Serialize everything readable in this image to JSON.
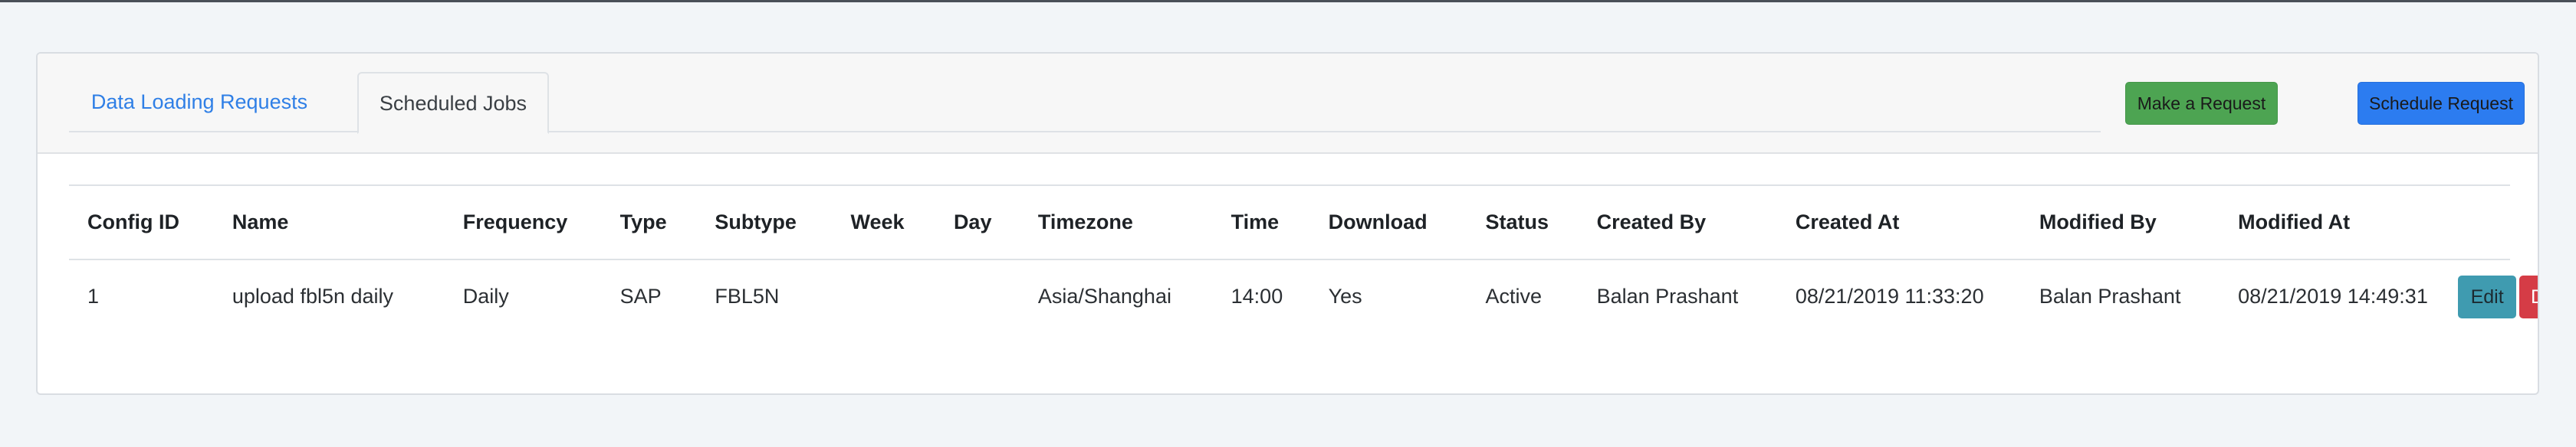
{
  "tabs": {
    "data_loading": "Data Loading Requests",
    "scheduled_jobs": "Scheduled Jobs"
  },
  "actions": {
    "make_request": "Make a Request",
    "schedule_request": "Schedule Request"
  },
  "table": {
    "headers": [
      "Config ID",
      "Name",
      "Frequency",
      "Type",
      "Subtype",
      "Week",
      "Day",
      "Timezone",
      "Time",
      "Download",
      "Status",
      "Created By",
      "Created At",
      "Modified By",
      "Modified At",
      ""
    ],
    "rows": [
      {
        "config_id": "1",
        "name": "upload fbl5n daily",
        "frequency": "Daily",
        "type": "SAP",
        "subtype": "FBL5N",
        "week": "",
        "day": "",
        "timezone": "Asia/Shanghai",
        "time": "14:00",
        "download": "Yes",
        "status": "Active",
        "created_by": "Balan Prashant",
        "created_at": "08/21/2019 11:33:20",
        "modified_by": "Balan Prashant",
        "modified_at": "08/21/2019 14:49:31",
        "edit_label": "Edit",
        "delete_label": "Delete"
      }
    ]
  },
  "colors": {
    "link": "#2f7fe6",
    "make_request_bg": "#4da452",
    "schedule_request_bg": "#2c7cf0",
    "edit_bg": "#3f9bb0",
    "delete_bg": "#d53c46"
  }
}
